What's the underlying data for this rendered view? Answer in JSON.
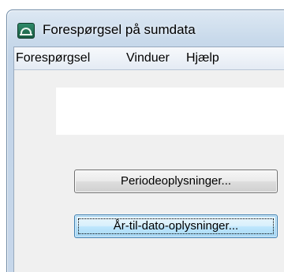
{
  "window": {
    "title": "Forespørgsel på sumdata",
    "icon": "app-logo-icon"
  },
  "menubar": {
    "items": [
      {
        "label": "Forespørgsel"
      },
      {
        "label": "Vinduer"
      },
      {
        "label": "Hjælp"
      }
    ]
  },
  "buttons": {
    "period": {
      "label": "Periodeoplysninger..."
    },
    "ytd": {
      "label": "År-til-dato-oplysninger..."
    }
  }
}
